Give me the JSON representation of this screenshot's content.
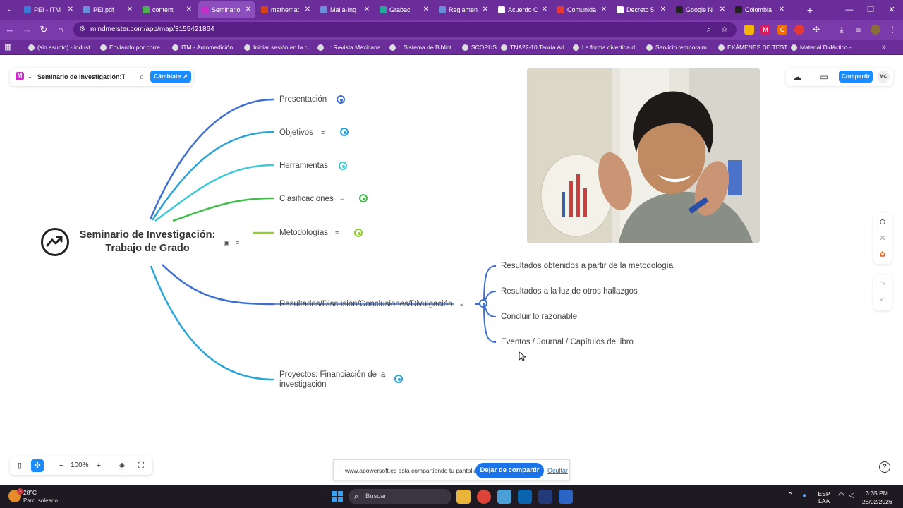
{
  "browser": {
    "tabs": [
      {
        "label": "PEI - ITM",
        "color": "#3a7bd5"
      },
      {
        "label": "PEI.pdf",
        "color": "#6a8fd8"
      },
      {
        "label": "content",
        "color": "#4caf50"
      },
      {
        "label": "Seminario",
        "color": "#c42ec7"
      },
      {
        "label": "mathemat",
        "color": "#d84315"
      },
      {
        "label": "Malla-Ing",
        "color": "#6a8fd8"
      },
      {
        "label": "Grabac",
        "color": "#26a69a"
      },
      {
        "label": "Reglamen",
        "color": "#6a8fd8"
      },
      {
        "label": "Acuerdo C",
        "color": "#ffffff"
      },
      {
        "label": "Comunida",
        "color": "#e53935"
      },
      {
        "label": "Decreto 5",
        "color": "#ffffff"
      },
      {
        "label": "Google N",
        "color": "#222222"
      },
      {
        "label": "Colombia",
        "color": "#222222"
      }
    ],
    "active_tab_index": 3,
    "url": "mindmeister.com/app/map/3155421864",
    "bookmarks": [
      "(sin asunto) - indust...",
      "Enviando por corre...",
      "ITM - Automedición...",
      "Iniciar sesión en la c...",
      "..: Revista Mexicana...",
      ":: Sistema de Bibliot...",
      "SCOPUS",
      "TNA22-10 Teoría Ad...",
      "La forma divertida d...",
      "Servicio temporalm...",
      "EXÁMENES DE TEST...",
      "Material Didáctico -..."
    ]
  },
  "toolbar": {
    "map_title": "Seminario de Investigación:T...",
    "switch_label": "Cámbiate ↗",
    "share_label": "Compartir",
    "avatar_initials": "MC"
  },
  "mindmap": {
    "root": {
      "line1": "Seminario de Investigación:",
      "line2": "Trabajo de Grado"
    },
    "branches": [
      {
        "label": "Presentación",
        "color": "#3d6fd1"
      },
      {
        "label": "Objetivos",
        "color": "#2aa3d6"
      },
      {
        "label": "Herramientas",
        "color": "#3cc9d9"
      },
      {
        "label": "Clasificaciones",
        "color": "#3fbf4a"
      },
      {
        "label": "Metodologías",
        "color": "#8dd12b"
      },
      {
        "label": "Resultados/Discusión/Conclusiones/Divulgación",
        "color": "#3d6fd1"
      },
      {
        "label": "Proyectos: Financiación de la investigación",
        "color": "#2aa3d6"
      }
    ],
    "sub_nodes": [
      "Resultados obtenidos a partir de la metodología",
      "Resultados a la luz de otros hallazgos",
      "Concluir lo razonable",
      "Eventos / Journal / Capítulos de libro"
    ]
  },
  "zoom": {
    "level": "100%"
  },
  "share_banner": {
    "message": "www.apowersoft.es está compartiendo tu pantalla.",
    "stop_label": "Dejar de compartir",
    "hide_label": "Ocultar"
  },
  "taskbar": {
    "weather_temp": "28°C",
    "weather_desc": "Parc. soleado",
    "weather_badge": "1",
    "search_placeholder": "Buscar",
    "lang_top": "ESP",
    "lang_bottom": "LAA",
    "time": "3:35 PM",
    "date": "28/02/2026"
  }
}
